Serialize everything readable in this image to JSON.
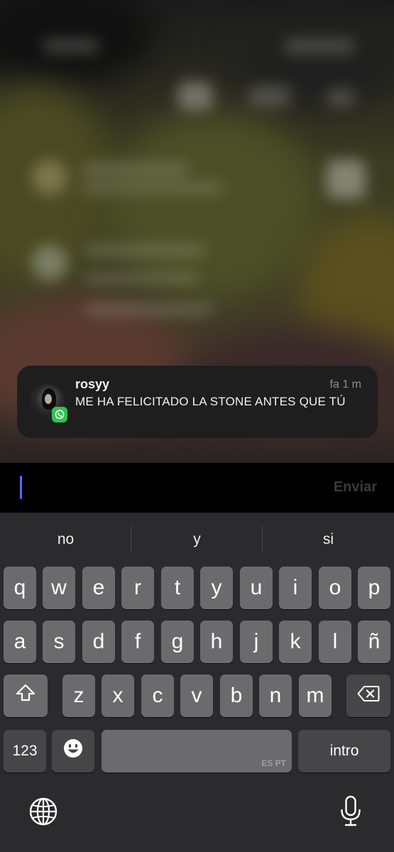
{
  "notification": {
    "sender": "rosyy",
    "time": "fa 1 m",
    "message": "ME HA FELICITADO LA STONE ANTES QUE TÚ",
    "app_icon": "whatsapp-icon"
  },
  "input": {
    "value": "",
    "send_label": "Enviar"
  },
  "keyboard": {
    "suggestions": [
      "no",
      "y",
      "si"
    ],
    "row1": [
      "q",
      "w",
      "e",
      "r",
      "t",
      "y",
      "u",
      "i",
      "o",
      "p"
    ],
    "row2": [
      "a",
      "s",
      "d",
      "f",
      "g",
      "h",
      "j",
      "k",
      "l",
      "ñ"
    ],
    "row3": [
      "z",
      "x",
      "c",
      "v",
      "b",
      "n",
      "m"
    ],
    "numbers_label": "123",
    "return_label": "intro",
    "space_languages": "ES PT",
    "icons": {
      "shift": "shift-icon",
      "delete": "backspace-icon",
      "emoji": "emoji-icon",
      "globe": "globe-icon",
      "dictation": "microphone-icon"
    }
  },
  "colors": {
    "notification_bg": "#1e1e1f",
    "keyboard_bg": "#2b2b2d",
    "key_bg": "#6b6b6d",
    "key_dark_bg": "#464648",
    "cursor": "#5a6cff",
    "whatsapp": "#2fc350"
  }
}
